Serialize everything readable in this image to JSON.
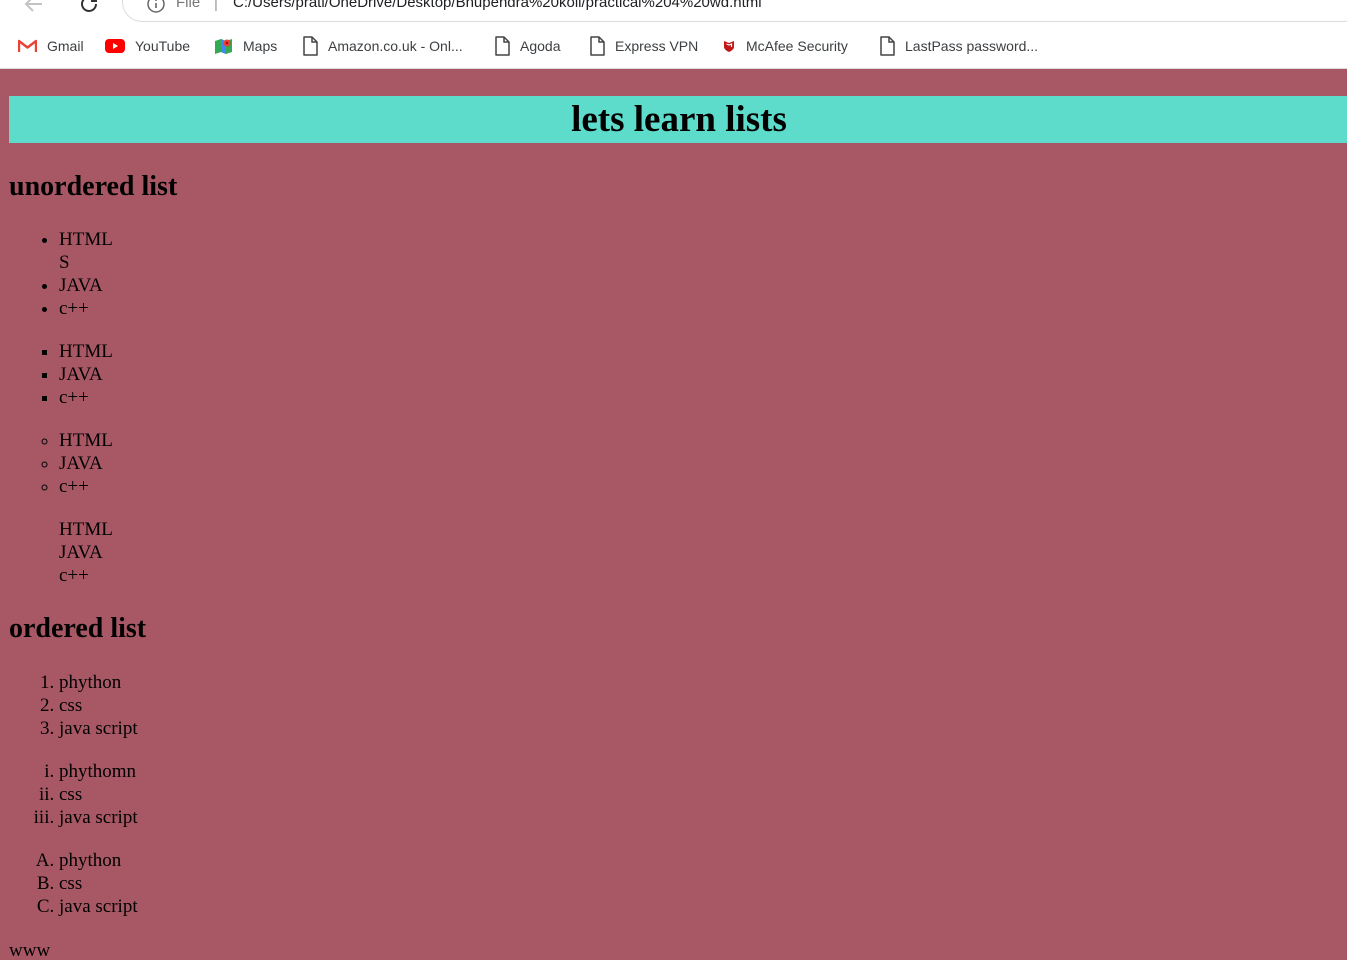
{
  "browser": {
    "url_scheme": "File",
    "url_separator": "|",
    "url": "C:/Users/prati/OneDrive/Desktop/Bhupendra%20koli/practical%204%20wd.html",
    "bookmarks": [
      {
        "label": "Gmail",
        "icon": "gmail-icon"
      },
      {
        "label": "YouTube",
        "icon": "youtube-icon"
      },
      {
        "label": "Maps",
        "icon": "maps-icon"
      },
      {
        "label": "Amazon.co.uk - Onl...",
        "icon": "page-icon"
      },
      {
        "label": "Agoda",
        "icon": "page-icon"
      },
      {
        "label": "Express VPN",
        "icon": "page-icon"
      },
      {
        "label": "McAfee Security",
        "icon": "mcafee-icon"
      },
      {
        "label": "LastPass password...",
        "icon": "page-icon"
      }
    ]
  },
  "page": {
    "background_color": "#a85865",
    "banner_color": "#5edccb",
    "title": "lets learn lists",
    "unordered_heading": "unordered list",
    "disc_list": [
      "HTML\nS",
      "JAVA",
      "c++"
    ],
    "square_list": [
      "HTML",
      "JAVA",
      "c++"
    ],
    "circle_list": [
      "HTML",
      "JAVA",
      "c++"
    ],
    "plain_list": [
      "HTML",
      "JAVA",
      "c++"
    ],
    "ordered_heading": "ordered list",
    "decimal_list": [
      "phython",
      "css",
      "java script"
    ],
    "roman_list": [
      "phythomn",
      "css",
      "java script"
    ],
    "alpha_list": [
      "phython",
      "css",
      "java script"
    ],
    "tail_text": "www"
  }
}
